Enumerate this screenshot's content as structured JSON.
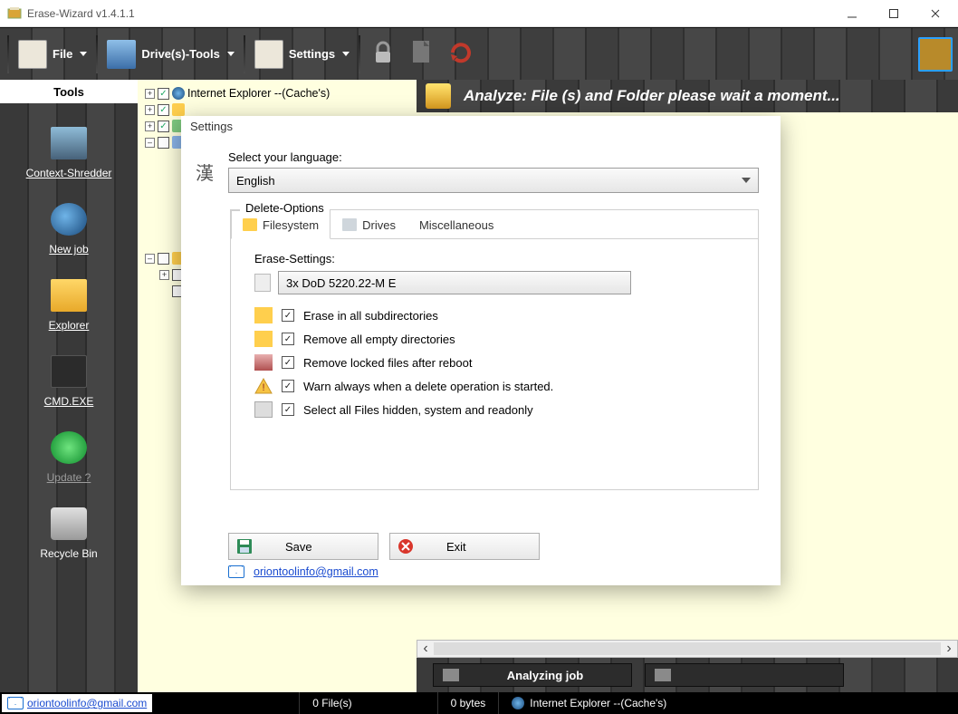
{
  "window": {
    "title": "Erase-Wizard v1.4.1.1"
  },
  "ribbon": {
    "file": "File",
    "drives": "Drive(s)-Tools",
    "settings": "Settings"
  },
  "sidebar": {
    "header": "Tools",
    "items": [
      {
        "label": "Context-Shredder"
      },
      {
        "label": "New job"
      },
      {
        "label": "Explorer"
      },
      {
        "label": "CMD.EXE"
      },
      {
        "label": "Update ?"
      },
      {
        "label": "Recycle Bin"
      }
    ]
  },
  "tree": {
    "row0": "Internet Explorer  --(Cache's)"
  },
  "banner": "Analyze: File (s) and Folder  please wait a moment...",
  "jobboxes": {
    "a": "Analyzing job",
    "b": ""
  },
  "statusbar": {
    "email": "oriontoolinfo@gmail.com",
    "files": "0 File(s)",
    "bytes": "0 bytes",
    "target": "Internet Explorer  --(Cache's)"
  },
  "settings": {
    "title": "Settings",
    "lang_label": "Select your language:",
    "lang_value": "English",
    "group_title": "Delete-Options",
    "tabs": {
      "filesystem": "Filesystem",
      "drives": "Drives",
      "misc": "Miscellaneous"
    },
    "erase_label": "Erase-Settings:",
    "erase_value": "3x   DoD 5220.22-M E",
    "opts": {
      "sub": "Erase in all subdirectories",
      "empty": "Remove all empty directories",
      "locked": "Remove locked files after reboot",
      "warn": "Warn always when a delete operation is started.",
      "hidden": "Select all Files hidden, system and readonly"
    },
    "save": "Save",
    "exit": "Exit",
    "mail": "oriontoolinfo@gmail.com"
  },
  "icons": {
    "kanji": "漢"
  }
}
